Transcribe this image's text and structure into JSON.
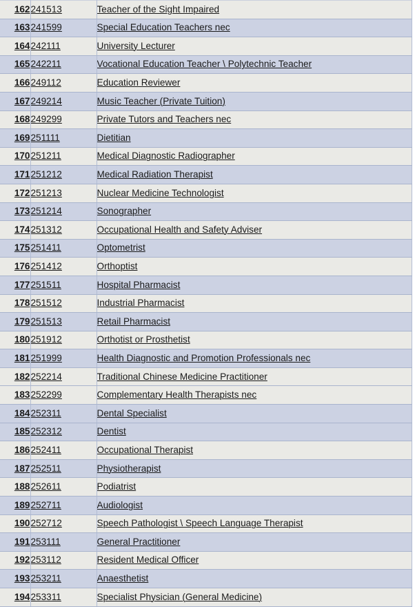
{
  "table": {
    "columns": [
      "index",
      "code",
      "title"
    ],
    "rows": [
      {
        "index": "162",
        "code": "241513",
        "title": "Teacher of the Sight Impaired",
        "tint": "light"
      },
      {
        "index": "163",
        "code": "241599",
        "title": "Special Education Teachers nec",
        "tint": "blue"
      },
      {
        "index": "164",
        "code": "242111",
        "title": "University Lecturer",
        "tint": "light"
      },
      {
        "index": "165",
        "code": "242211",
        "title": "Vocational Education Teacher \\ Polytechnic Teacher",
        "tint": "blue"
      },
      {
        "index": "166",
        "code": "249112",
        "title": "Education Reviewer",
        "tint": "light"
      },
      {
        "index": "167",
        "code": "249214",
        "title": "Music Teacher (Private Tuition)",
        "tint": "blue"
      },
      {
        "index": "168",
        "code": "249299",
        "title": "Private Tutors and Teachers nec",
        "tint": "light"
      },
      {
        "index": "169",
        "code": "251111",
        "title": "Dietitian",
        "tint": "blue"
      },
      {
        "index": "170",
        "code": "251211",
        "title": "Medical Diagnostic Radiographer",
        "tint": "light"
      },
      {
        "index": "171",
        "code": "251212",
        "title": "Medical Radiation Therapist",
        "tint": "blue"
      },
      {
        "index": "172",
        "code": "251213",
        "title": "Nuclear Medicine Technologist",
        "tint": "light"
      },
      {
        "index": "173",
        "code": "251214",
        "title": "Sonographer",
        "tint": "blue"
      },
      {
        "index": "174",
        "code": "251312",
        "title": "Occupational Health and Safety Adviser",
        "tint": "light"
      },
      {
        "index": "175",
        "code": "251411",
        "title": "Optometrist",
        "tint": "blue"
      },
      {
        "index": "176",
        "code": "251412",
        "title": "Orthoptist",
        "tint": "light"
      },
      {
        "index": "177",
        "code": "251511",
        "title": "Hospital Pharmacist",
        "tint": "blue"
      },
      {
        "index": "178",
        "code": "251512",
        "title": "Industrial Pharmacist",
        "tint": "light"
      },
      {
        "index": "179",
        "code": "251513",
        "title": "Retail Pharmacist",
        "tint": "blue"
      },
      {
        "index": "180",
        "code": "251912",
        "title": "Orthotist or Prosthetist",
        "tint": "light"
      },
      {
        "index": "181",
        "code": "251999",
        "title": "Health Diagnostic and Promotion Professionals nec",
        "tint": "blue"
      },
      {
        "index": "182",
        "code": "252214",
        "title": "Traditional Chinese Medicine Practitioner",
        "tint": "light"
      },
      {
        "index": "183",
        "code": "252299",
        "title": "Complementary Health Therapists nec",
        "tint": "light"
      },
      {
        "index": "184",
        "code": "252311",
        "title": "Dental Specialist",
        "tint": "blue"
      },
      {
        "index": "185",
        "code": "252312",
        "title": "Dentist",
        "tint": "blue"
      },
      {
        "index": "186",
        "code": "252411",
        "title": "Occupational Therapist",
        "tint": "light"
      },
      {
        "index": "187",
        "code": "252511",
        "title": "Physiotherapist",
        "tint": "blue"
      },
      {
        "index": "188",
        "code": "252611",
        "title": "Podiatrist",
        "tint": "light"
      },
      {
        "index": "189",
        "code": "252711",
        "title": "Audiologist",
        "tint": "blue"
      },
      {
        "index": "190",
        "code": "252712",
        "title": "Speech Pathologist \\ Speech Language Therapist",
        "tint": "light"
      },
      {
        "index": "191",
        "code": "253111",
        "title": "General Practitioner",
        "tint": "blue"
      },
      {
        "index": "192",
        "code": "253112",
        "title": "Resident Medical Officer",
        "tint": "light"
      },
      {
        "index": "193",
        "code": "253211",
        "title": "Anaesthetist",
        "tint": "blue"
      },
      {
        "index": "194",
        "code": "253311",
        "title": "Specialist Physician (General Medicine)",
        "tint": "light"
      }
    ]
  },
  "colors": {
    "row_light": "#eaeae6",
    "row_blue": "#ccd2e3",
    "border": "#a9b4cd",
    "text": "#1a1a1a",
    "page_background": "#ffffff"
  }
}
